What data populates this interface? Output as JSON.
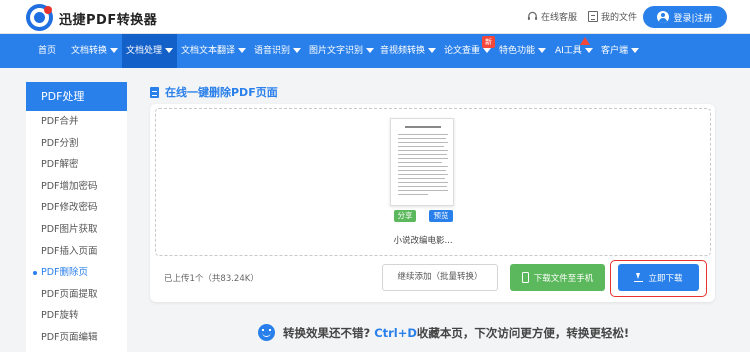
{
  "header": {
    "brand": "迅捷PDF转换器",
    "service_label": "在线客服",
    "my_files_label": "我的文件",
    "login_label": "登录|注册"
  },
  "nav": {
    "items": [
      {
        "label": "首页",
        "has_caret": false
      },
      {
        "label": "文档转换",
        "has_caret": true
      },
      {
        "label": "文档处理",
        "has_caret": true,
        "active": true
      },
      {
        "label": "文档文本翻译",
        "has_caret": true
      },
      {
        "label": "语音识别",
        "has_caret": true
      },
      {
        "label": "图片文字识别",
        "has_caret": true
      },
      {
        "label": "音视频转换",
        "has_caret": true
      },
      {
        "label": "论文查重",
        "has_caret": true
      },
      {
        "label": "特色功能",
        "has_caret": true
      },
      {
        "label": "AI工具",
        "has_caret": true
      },
      {
        "label": "客户端",
        "has_caret": true
      }
    ],
    "new_badge": "新"
  },
  "sidebar": {
    "header": "PDF处理",
    "items": [
      {
        "label": "PDF合并"
      },
      {
        "label": "PDF分割"
      },
      {
        "label": "PDF解密"
      },
      {
        "label": "PDF增加密码"
      },
      {
        "label": "PDF修改密码"
      },
      {
        "label": "PDF图片获取"
      },
      {
        "label": "PDF插入页面"
      },
      {
        "label": "PDF删除页",
        "active": true
      },
      {
        "label": "PDF页面提取"
      },
      {
        "label": "PDF旋转"
      },
      {
        "label": "PDF页面编辑"
      }
    ]
  },
  "main": {
    "title": "在线一键删除PDF页面",
    "file": {
      "name": "小说改编电影...",
      "share_label": "分享",
      "preview_label": "预览"
    },
    "upload_status": "已上传1个（共83.24K）",
    "continue_label": "继续添加（批量转换）",
    "phone_label": "下载文件至手机",
    "download_label": "立即下载"
  },
  "tip": {
    "prefix": "转换效果还不错?",
    "shortcut": "Ctrl+D",
    "suffix": "收藏本页，下次访问更方便，转换更轻松!"
  },
  "colors": {
    "primary": "#2a80ea",
    "nav_active": "#1460c9",
    "green": "#5cb85c",
    "highlight_red": "#e8322d"
  }
}
